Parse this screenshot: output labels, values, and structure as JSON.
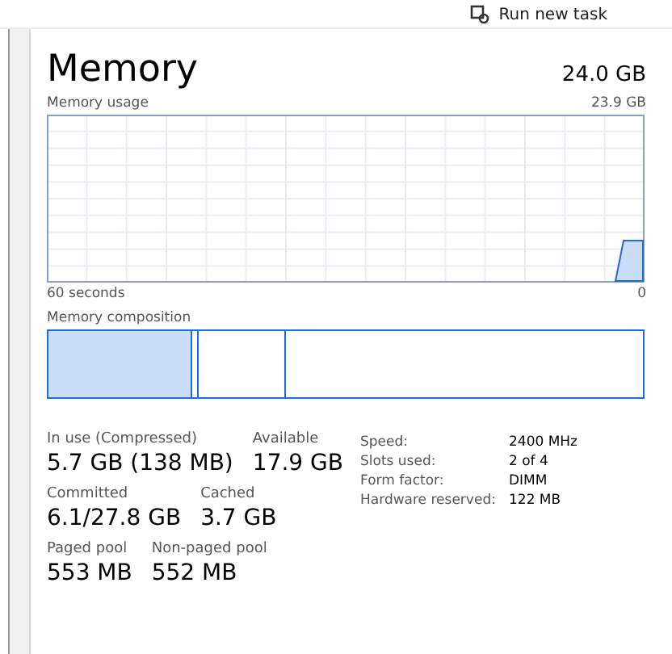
{
  "toolbar": {
    "run_task": "Run new task"
  },
  "header": {
    "title": "Memory",
    "total": "24.0 GB"
  },
  "usage_graph": {
    "label": "Memory usage",
    "max": "23.9 GB",
    "left_axis": "60 seconds",
    "right_axis": "0"
  },
  "composition": {
    "label": "Memory composition"
  },
  "stats": [
    [
      {
        "label": "In use (Compressed)",
        "value": "5.7 GB (138 MB)"
      },
      {
        "label": "Available",
        "value": "17.9 GB"
      }
    ],
    [
      {
        "label": "Committed",
        "value": "6.1/27.8 GB"
      },
      {
        "label": "Cached",
        "value": "3.7 GB"
      }
    ],
    [
      {
        "label": "Paged pool",
        "value": "553 MB"
      },
      {
        "label": "Non-paged pool",
        "value": "552 MB"
      }
    ]
  ],
  "details": [
    {
      "label": "Speed:",
      "value": "2400 MHz"
    },
    {
      "label": "Slots used:",
      "value": "2 of 4"
    },
    {
      "label": "Form factor:",
      "value": "DIMM"
    },
    {
      "label": "Hardware reserved:",
      "value": "122 MB"
    }
  ]
}
